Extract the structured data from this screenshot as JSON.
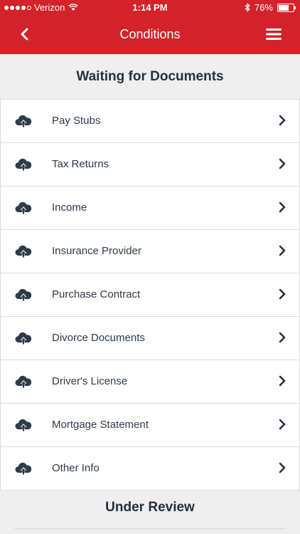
{
  "status_bar": {
    "carrier": "Verizon",
    "time": "1:14 PM",
    "battery": "76%",
    "battery_level": 0.76
  },
  "nav": {
    "title": "Conditions"
  },
  "sections": {
    "waiting_title": "Waiting for Documents",
    "review_title": "Under Review"
  },
  "waiting_items": [
    {
      "label": "Pay Stubs",
      "icon": "cloud-upload-icon"
    },
    {
      "label": "Tax Returns",
      "icon": "cloud-upload-icon"
    },
    {
      "label": "Income",
      "icon": "cloud-upload-icon"
    },
    {
      "label": "Insurance Provider",
      "icon": "cloud-upload-icon"
    },
    {
      "label": "Purchase Contract",
      "icon": "cloud-upload-icon"
    },
    {
      "label": "Divorce Documents",
      "icon": "cloud-upload-icon"
    },
    {
      "label": "Driver's License",
      "icon": "cloud-upload-icon"
    },
    {
      "label": "Mortgage Statement",
      "icon": "cloud-upload-icon"
    },
    {
      "label": "Other Info",
      "icon": "cloud-upload-icon"
    }
  ],
  "colors": {
    "brand_red": "#d32229",
    "text_dark": "#243041",
    "background": "#efefef"
  }
}
